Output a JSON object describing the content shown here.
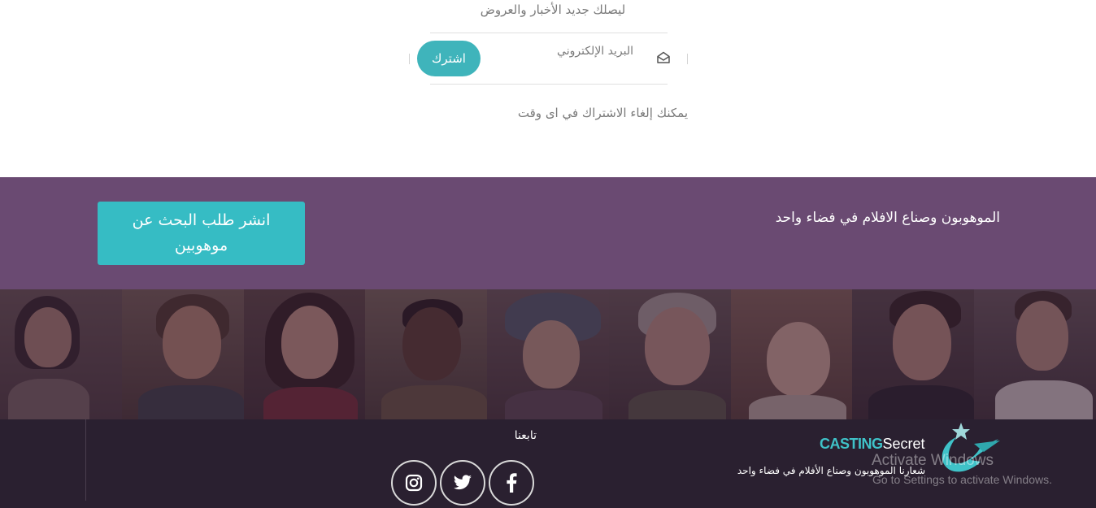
{
  "newsletter": {
    "heading": "ليصلك جديد الأخبار والعروض",
    "email_placeholder": "البريد الإلكتروني",
    "subscribe_label": "اشترك",
    "note": "يمكنك إلغاء الاشتراك في اى وقت",
    "mail_icon": "envelope-open-icon"
  },
  "band": {
    "tagline": "الموهوبون وصناع الافلام في فضاء واحد",
    "post_button_label": "انشر طلب البحث عن موهوبين"
  },
  "faces_strip": {
    "count": 9
  },
  "footer": {
    "follow_label": "تابعنا",
    "social": [
      {
        "name": "instagram-icon"
      },
      {
        "name": "twitter-icon"
      },
      {
        "name": "facebook-icon"
      }
    ],
    "brand_part1": "CASTING",
    "brand_part2": "Secret",
    "slogan": "شعارنا الموهوبون وصناع الأفلام في فضاء واحد",
    "logo": "star-swoosh-logo-icon"
  },
  "watermark": {
    "title": "Activate Windows",
    "subtitle": "Go to Settings to activate Windows."
  },
  "colors": {
    "accent": "#3fb4bb",
    "band_purple": "#6a4a72",
    "footer_dark": "#2a2030",
    "brand_teal": "#3fc2c8"
  }
}
